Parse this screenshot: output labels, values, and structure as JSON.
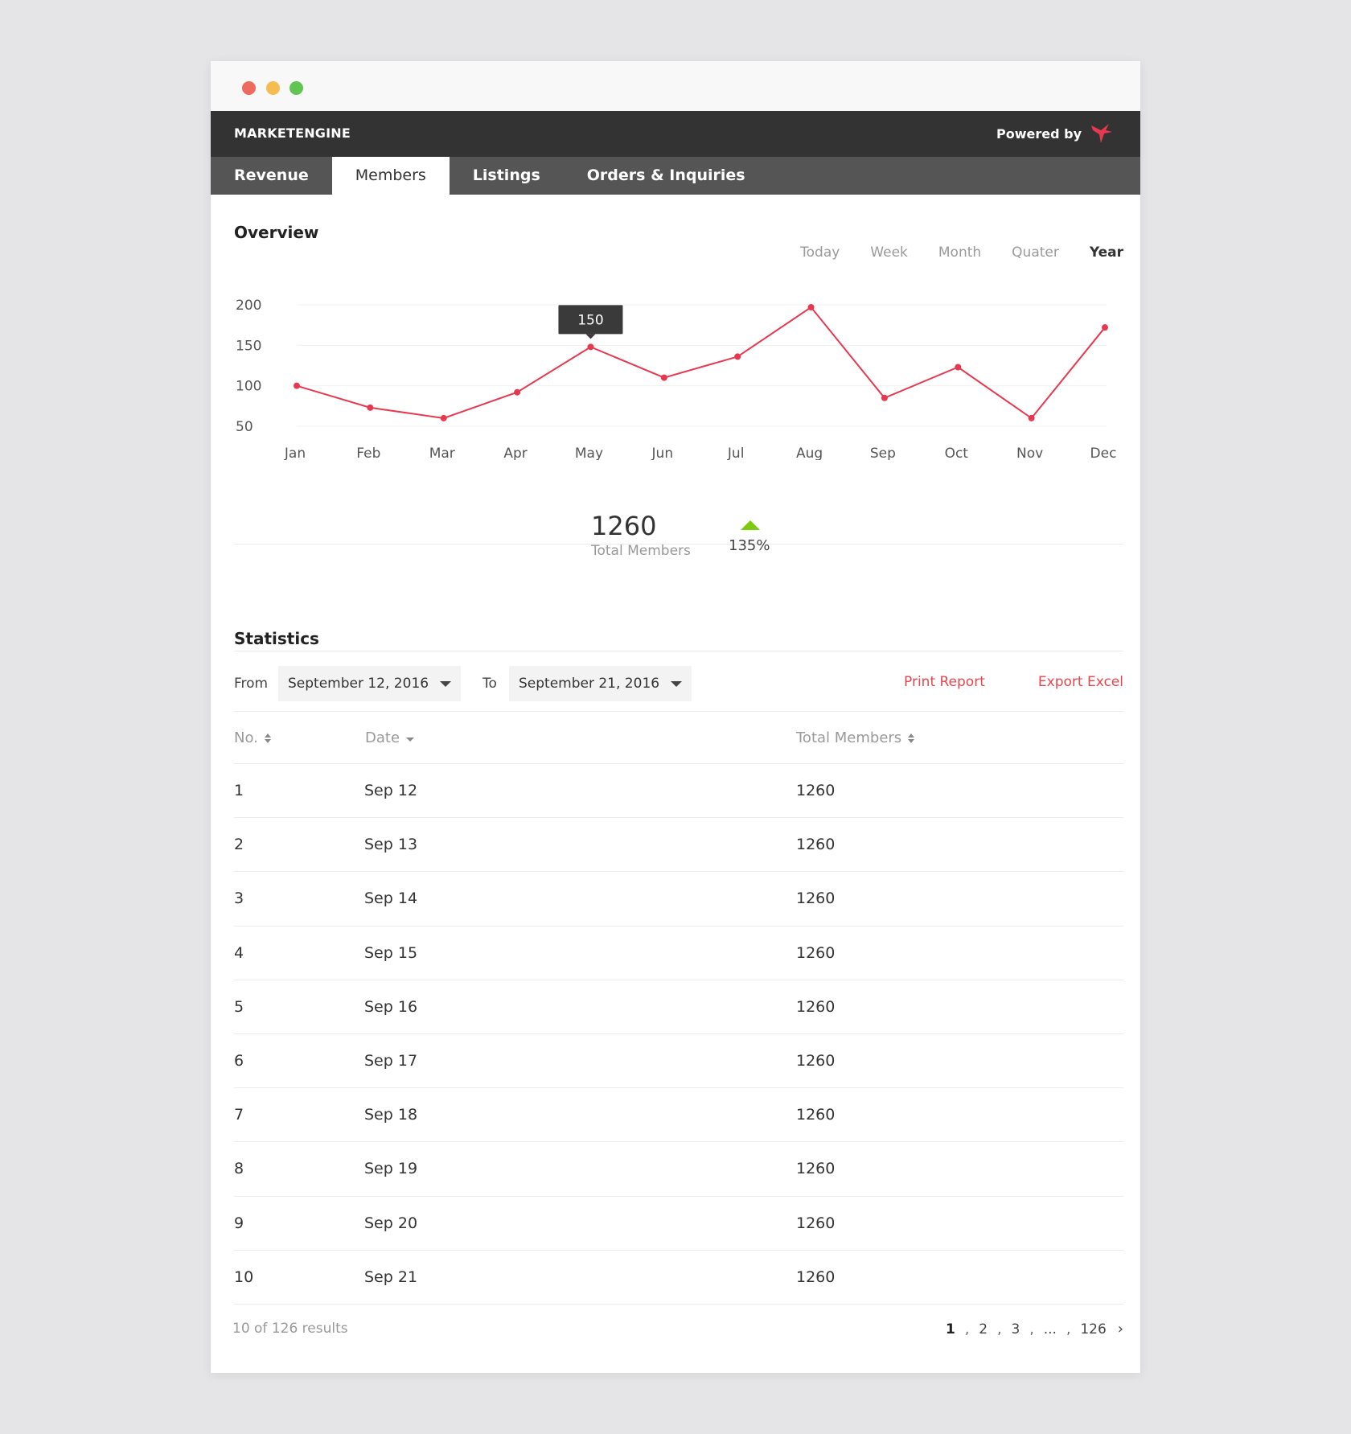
{
  "window": {
    "controls": [
      "close",
      "minimize",
      "maximize"
    ]
  },
  "appbar": {
    "brand": "MARKETENGINE",
    "powered_by": "Powered by",
    "logo_icon": "hummingbird-icon"
  },
  "tabs": [
    {
      "label": "Revenue",
      "active": false
    },
    {
      "label": "Members",
      "active": true
    },
    {
      "label": "Listings",
      "active": false
    },
    {
      "label": "Orders & Inquiries",
      "active": false
    }
  ],
  "overview": {
    "title": "Overview",
    "ranges": [
      "Today",
      "Week",
      "Month",
      "Quater",
      "Year"
    ],
    "active_range": "Year",
    "tooltip": "150"
  },
  "chart_data": {
    "type": "line",
    "categories": [
      "Jan",
      "Feb",
      "Mar",
      "Apr",
      "May",
      "Jun",
      "Jul",
      "Aug",
      "Sep",
      "Oct",
      "Nov",
      "Dec"
    ],
    "series": [
      {
        "values": [
          100,
          73,
          60,
          92,
          148,
          110,
          136,
          197,
          85,
          123,
          60,
          172
        ],
        "color": "#e8384f"
      }
    ],
    "yticks": [
      200,
      150,
      100,
      50
    ],
    "ylim": [
      50,
      200
    ],
    "grid": true,
    "highlight_index": 4
  },
  "kpi": {
    "value": "1260",
    "label": "Total Members",
    "change": "135%",
    "trend": "up",
    "trend_color": "#7ccb0f"
  },
  "statistics": {
    "title": "Statistics",
    "from_label": "From",
    "from_value": "September 12, 2016",
    "to_label": "To",
    "to_value": "September 21, 2016",
    "print_label": "Print Report",
    "export_label": "Export Excel"
  },
  "table": {
    "headers": {
      "no": "No.",
      "date": "Date",
      "total": "Total Members"
    },
    "rows": [
      {
        "no": "1",
        "date": "Sep 12",
        "total": "1260"
      },
      {
        "no": "2",
        "date": "Sep 13",
        "total": "1260"
      },
      {
        "no": "3",
        "date": "Sep 14",
        "total": "1260"
      },
      {
        "no": "4",
        "date": "Sep 15",
        "total": "1260"
      },
      {
        "no": "5",
        "date": "Sep 16",
        "total": "1260"
      },
      {
        "no": "6",
        "date": "Sep 17",
        "total": "1260"
      },
      {
        "no": "7",
        "date": "Sep 18",
        "total": "1260"
      },
      {
        "no": "8",
        "date": "Sep 19",
        "total": "1260"
      },
      {
        "no": "9",
        "date": "Sep 20",
        "total": "1260"
      },
      {
        "no": "10",
        "date": "Sep 21",
        "total": "1260"
      }
    ]
  },
  "pagination": {
    "summary": "10 of 126 results",
    "pages": [
      "1",
      "2",
      "3",
      "...",
      "126"
    ],
    "current": "1",
    "next_icon": "chevron-right-icon"
  },
  "colors": {
    "accent": "#e8464e",
    "appbar": "#333333",
    "tabbar": "#555555"
  }
}
